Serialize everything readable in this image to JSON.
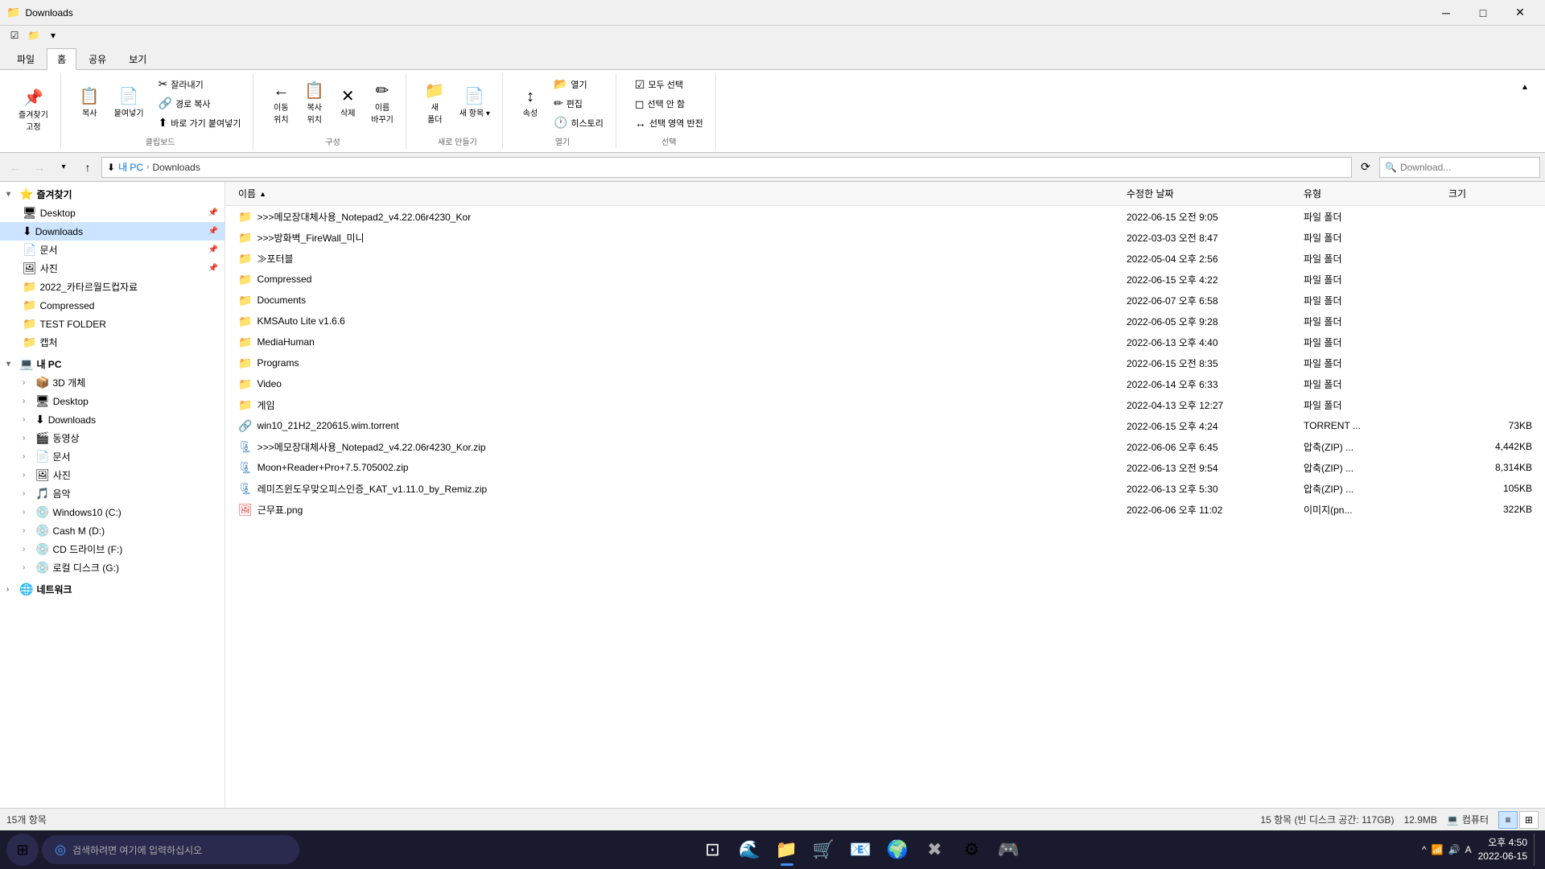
{
  "titleBar": {
    "icon": "📁",
    "title": "Downloads",
    "minBtn": "─",
    "maxBtn": "□",
    "closeBtn": "✕"
  },
  "ribbon": {
    "tabs": [
      "파일",
      "홈",
      "공유",
      "보기"
    ],
    "activeTab": "홈",
    "groups": [
      {
        "label": "즐겨찾기 고정",
        "items": [
          {
            "icon": "📌",
            "label": "즐겨찾기\n고정"
          }
        ]
      },
      {
        "label": "클립보드",
        "items": [
          {
            "icon": "📋",
            "label": "복사"
          },
          {
            "icon": "📄",
            "label": "붙여넣기"
          },
          {
            "small": true,
            "items": [
              {
                "icon": "✂",
                "label": "잘라내기"
              },
              {
                "icon": "🔗",
                "label": "경로 복사"
              },
              {
                "icon": "⬆",
                "label": "바로 가기 붙여넣기"
              }
            ]
          }
        ]
      },
      {
        "label": "구성",
        "items": [
          {
            "icon": "←",
            "label": "이동\n위치"
          },
          {
            "icon": "📋",
            "label": "복사\n위치"
          },
          {
            "icon": "✕",
            "label": "삭제"
          },
          {
            "icon": "✏",
            "label": "이름\n바꾸기"
          }
        ]
      },
      {
        "label": "새로 만들기",
        "items": [
          {
            "icon": "📁",
            "label": "새\n폴더"
          },
          {
            "icon": "📄",
            "label": "새 항목 ▾"
          }
        ]
      },
      {
        "label": "열기",
        "items": [
          {
            "icon": "↕",
            "label": "속성"
          },
          {
            "small": true,
            "items": [
              {
                "icon": "📂",
                "label": "열기"
              },
              {
                "icon": "✏",
                "label": "편집"
              },
              {
                "icon": "🕐",
                "label": "히스토리"
              }
            ]
          }
        ]
      },
      {
        "label": "선택",
        "items": [
          {
            "small": true,
            "items": [
              {
                "icon": "☑",
                "label": "모두 선택"
              },
              {
                "icon": "◻",
                "label": "선택 안 함"
              },
              {
                "icon": "↔",
                "label": "선택 영역 반전"
              }
            ]
          }
        ]
      }
    ]
  },
  "addressBar": {
    "back": "←",
    "forward": "→",
    "up": "↑",
    "recent": "▾",
    "breadcrumbs": [
      "내 PC",
      "Downloads"
    ],
    "refresh": "⟳",
    "search": "Download..."
  },
  "sidebar": {
    "sections": [
      {
        "name": "즐겨찾기",
        "expanded": true,
        "icon": "⭐",
        "items": [
          {
            "label": "Desktop",
            "icon": "🖥",
            "indent": 1,
            "pinned": true
          },
          {
            "label": "Downloads",
            "icon": "⬇",
            "indent": 1,
            "pinned": true,
            "selected": true
          },
          {
            "label": "문서",
            "icon": "📄",
            "indent": 1,
            "pinned": true
          },
          {
            "label": "사진",
            "icon": "🖼",
            "indent": 1,
            "pinned": true
          },
          {
            "label": "2022_카타르월드컵자료",
            "icon": "📁",
            "indent": 1
          },
          {
            "label": "Compressed",
            "icon": "📁",
            "indent": 1
          },
          {
            "label": "TEST FOLDER",
            "icon": "📁",
            "indent": 1
          },
          {
            "label": "캡처",
            "icon": "📁",
            "indent": 1
          }
        ]
      },
      {
        "name": "내 PC",
        "expanded": true,
        "icon": "💻",
        "items": [
          {
            "label": "3D 개체",
            "icon": "📦",
            "indent": 1,
            "hasArrow": true
          },
          {
            "label": "Desktop",
            "icon": "🖥",
            "indent": 1,
            "hasArrow": true
          },
          {
            "label": "Downloads",
            "icon": "⬇",
            "indent": 1,
            "hasArrow": true
          },
          {
            "label": "동영상",
            "icon": "🎬",
            "indent": 1,
            "hasArrow": true
          },
          {
            "label": "문서",
            "icon": "📄",
            "indent": 1,
            "hasArrow": true
          },
          {
            "label": "사진",
            "icon": "🖼",
            "indent": 1,
            "hasArrow": true
          },
          {
            "label": "음악",
            "icon": "🎵",
            "indent": 1,
            "hasArrow": true
          },
          {
            "label": "Windows10 (C:)",
            "icon": "💿",
            "indent": 1,
            "hasArrow": true
          },
          {
            "label": "Cash M (D:)",
            "icon": "💿",
            "indent": 1,
            "hasArrow": true
          },
          {
            "label": "CD 드라이브 (F:)",
            "icon": "💿",
            "indent": 1,
            "hasArrow": true
          },
          {
            "label": "로컬 디스크 (G:)",
            "icon": "💿",
            "indent": 1,
            "hasArrow": true
          }
        ]
      },
      {
        "name": "네트워크",
        "expanded": false,
        "icon": "🌐",
        "items": []
      }
    ]
  },
  "fileList": {
    "columns": [
      {
        "label": "이름",
        "class": "col-name"
      },
      {
        "label": "수정한 날짜",
        "class": "col-date"
      },
      {
        "label": "유형",
        "class": "col-type"
      },
      {
        "label": "크기",
        "class": "col-size"
      }
    ],
    "items": [
      {
        "name": ">>>메모장대체사용_Notepad2_v4.22.06r4230_Kor",
        "date": "2022-06-15  오전 9:05",
        "type": "파일 폴더",
        "size": "",
        "icon": "📁",
        "iconClass": "folder-icon"
      },
      {
        "name": ">>>방화벽_FireWall_미니",
        "date": "2022-03-03  오전 8:47",
        "type": "파일 폴더",
        "size": "",
        "icon": "📁",
        "iconClass": "folder-icon"
      },
      {
        "name": "≫포터블",
        "date": "2022-05-04  오후 2:56",
        "type": "파일 폴더",
        "size": "",
        "icon": "📁",
        "iconClass": "folder-icon"
      },
      {
        "name": "Compressed",
        "date": "2022-06-15  오후 4:22",
        "type": "파일 폴더",
        "size": "",
        "icon": "📁",
        "iconClass": "folder-icon"
      },
      {
        "name": "Documents",
        "date": "2022-06-07  오후 6:58",
        "type": "파일 폴더",
        "size": "",
        "icon": "📁",
        "iconClass": "folder-icon"
      },
      {
        "name": "KMSAuto Lite v1.6.6",
        "date": "2022-06-05  오후 9:28",
        "type": "파일 폴더",
        "size": "",
        "icon": "📁",
        "iconClass": "folder-icon"
      },
      {
        "name": "MediaHuman",
        "date": "2022-06-13  오후 4:40",
        "type": "파일 폴더",
        "size": "",
        "icon": "📁",
        "iconClass": "folder-icon"
      },
      {
        "name": "Programs",
        "date": "2022-06-15  오전 8:35",
        "type": "파일 폴더",
        "size": "",
        "icon": "📁",
        "iconClass": "folder-icon"
      },
      {
        "name": "Video",
        "date": "2022-06-14  오후 6:33",
        "type": "파일 폴더",
        "size": "",
        "icon": "📁",
        "iconClass": "folder-icon"
      },
      {
        "name": "게임",
        "date": "2022-04-13  오후 12:27",
        "type": "파일 폴더",
        "size": "",
        "icon": "📁",
        "iconClass": "folder-icon"
      },
      {
        "name": "win10_21H2_220615.wim.torrent",
        "date": "2022-06-15  오후 4:24",
        "type": "TORRENT ...",
        "size": "73KB",
        "icon": "🔗",
        "iconClass": "torrent-icon"
      },
      {
        "name": ">>>메모장대체사용_Notepad2_v4.22.06r4230_Kor.zip",
        "date": "2022-06-06  오후 6:45",
        "type": "압축(ZIP) ...",
        "size": "4,442KB",
        "icon": "🗜",
        "iconClass": "zip-icon"
      },
      {
        "name": "Moon+Reader+Pro+7.5.705002.zip",
        "date": "2022-06-13  오전 9:54",
        "type": "압축(ZIP) ...",
        "size": "8,314KB",
        "icon": "🗜",
        "iconClass": "zip-icon"
      },
      {
        "name": "레미즈윈도우맞오피스인증_KAT_v1.11.0_by_Remiz.zip",
        "date": "2022-06-13  오후 5:30",
        "type": "압축(ZIP) ...",
        "size": "105KB",
        "icon": "🗜",
        "iconClass": "zip-icon"
      },
      {
        "name": "근무표.png",
        "date": "2022-06-06  오후 11:02",
        "type": "이미지(pn...",
        "size": "322KB",
        "icon": "🖼",
        "iconClass": "img-icon"
      }
    ]
  },
  "statusBar": {
    "itemCount": "15개 항목",
    "diskInfo": "15 항목 (빈 디스크 공간: 117GB)",
    "fileSize": "12.9MB",
    "location": "컴퓨터"
  },
  "taskbar": {
    "searchPlaceholder": "검색하려면 여기에 입력하십시오",
    "time": "오후 4:50",
    "date": "2022-06-15",
    "apps": [
      "🔍",
      "🗂",
      "🌐",
      "📁",
      "🛒",
      "📧",
      "🌍",
      "⚙",
      "🎮"
    ],
    "systemIcons": [
      "^",
      "🔔",
      "📶",
      "🔊",
      "A"
    ]
  }
}
